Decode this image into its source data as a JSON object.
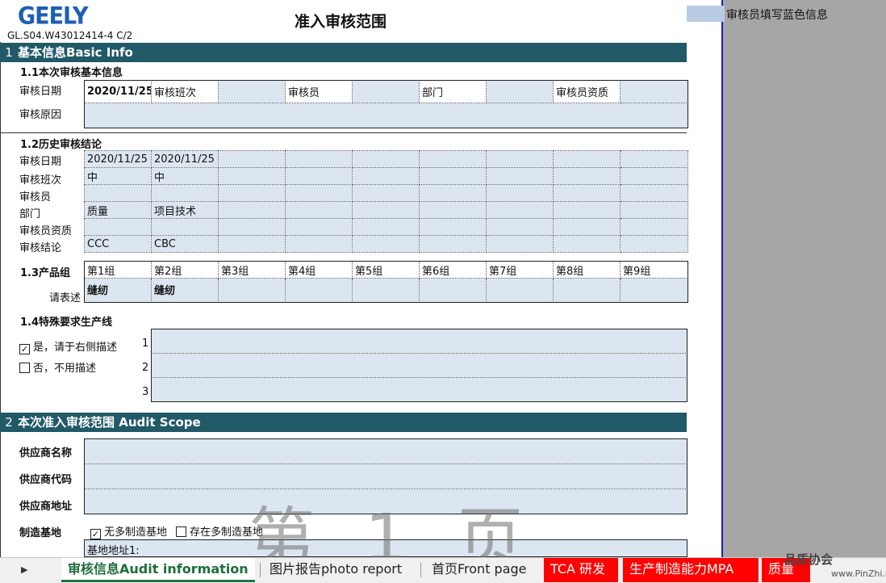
{
  "header": {
    "logo_text": "GEELY",
    "doc_code": "GL.S04.W43012414-4  C/2",
    "title": "准入审核范围",
    "legend_text": "审核员填写蓝色信息",
    "legend_color": "#b8cce4"
  },
  "section1": {
    "num": "1",
    "title": "基本信息Basic Info",
    "s11": {
      "title": "1.1本次审核基本信息",
      "date_label": "审核日期",
      "date_value": "2020/11/25",
      "shift_label": "审核班次",
      "auditor_label": "审核员",
      "dept_label": "部门",
      "qual_label": "审核员资质",
      "reason_label": "审核原因"
    },
    "s12": {
      "title": "1.2历史审核结论",
      "rows": [
        {
          "label": "审核日期",
          "values": [
            "2020/11/25",
            "2020/11/25"
          ]
        },
        {
          "label": "审核班次",
          "values": [
            "中",
            "中"
          ]
        },
        {
          "label": "审核员",
          "values": [
            "",
            ""
          ]
        },
        {
          "label": "部门",
          "values": [
            "质量",
            "项目技术"
          ]
        },
        {
          "label": "审核员资质",
          "values": [
            "",
            ""
          ]
        },
        {
          "label": "审核结论",
          "values": [
            "CCC",
            "CBC"
          ]
        }
      ]
    },
    "s13": {
      "title": "1.3产品组",
      "describe_label": "请表述",
      "groups": [
        "第1组",
        "第2组",
        "第3组",
        "第4组",
        "第5组",
        "第6组",
        "第7组",
        "第8组",
        "第9组"
      ],
      "descriptions": [
        "缝纫",
        "缝纫",
        "",
        "",
        "",
        "",
        "",
        "",
        ""
      ]
    },
    "s14": {
      "title": "1.4特殊要求生产线",
      "yes_option": "是，请于右侧描述",
      "yes_checked": true,
      "no_option": "否，不用描述",
      "no_checked": false,
      "line_numbers": [
        "1",
        "2",
        "3"
      ]
    }
  },
  "section2": {
    "num": "2",
    "title": "本次准入审核范围 Audit Scope",
    "supplier_name_label": "供应商名称",
    "supplier_code_label": "供应商代码",
    "supplier_addr_label": "供应商地址",
    "base_label": "制造基地",
    "no_multi_base": "无多制造基地",
    "no_multi_checked": true,
    "multi_base": "存在多制造基地",
    "multi_checked": false,
    "base_address_label": "基地地址1:"
  },
  "watermark": "第 1 页",
  "tabs": {
    "active": "审核信息Audit information",
    "photo": "图片报告photo report",
    "front": "首页Front page",
    "tca": "TCA 研发",
    "mpa": "生产制造能力MPA",
    "quality": "质量"
  },
  "corner_logo": "品质协会",
  "corner_url": "www.PinZhi.org"
}
